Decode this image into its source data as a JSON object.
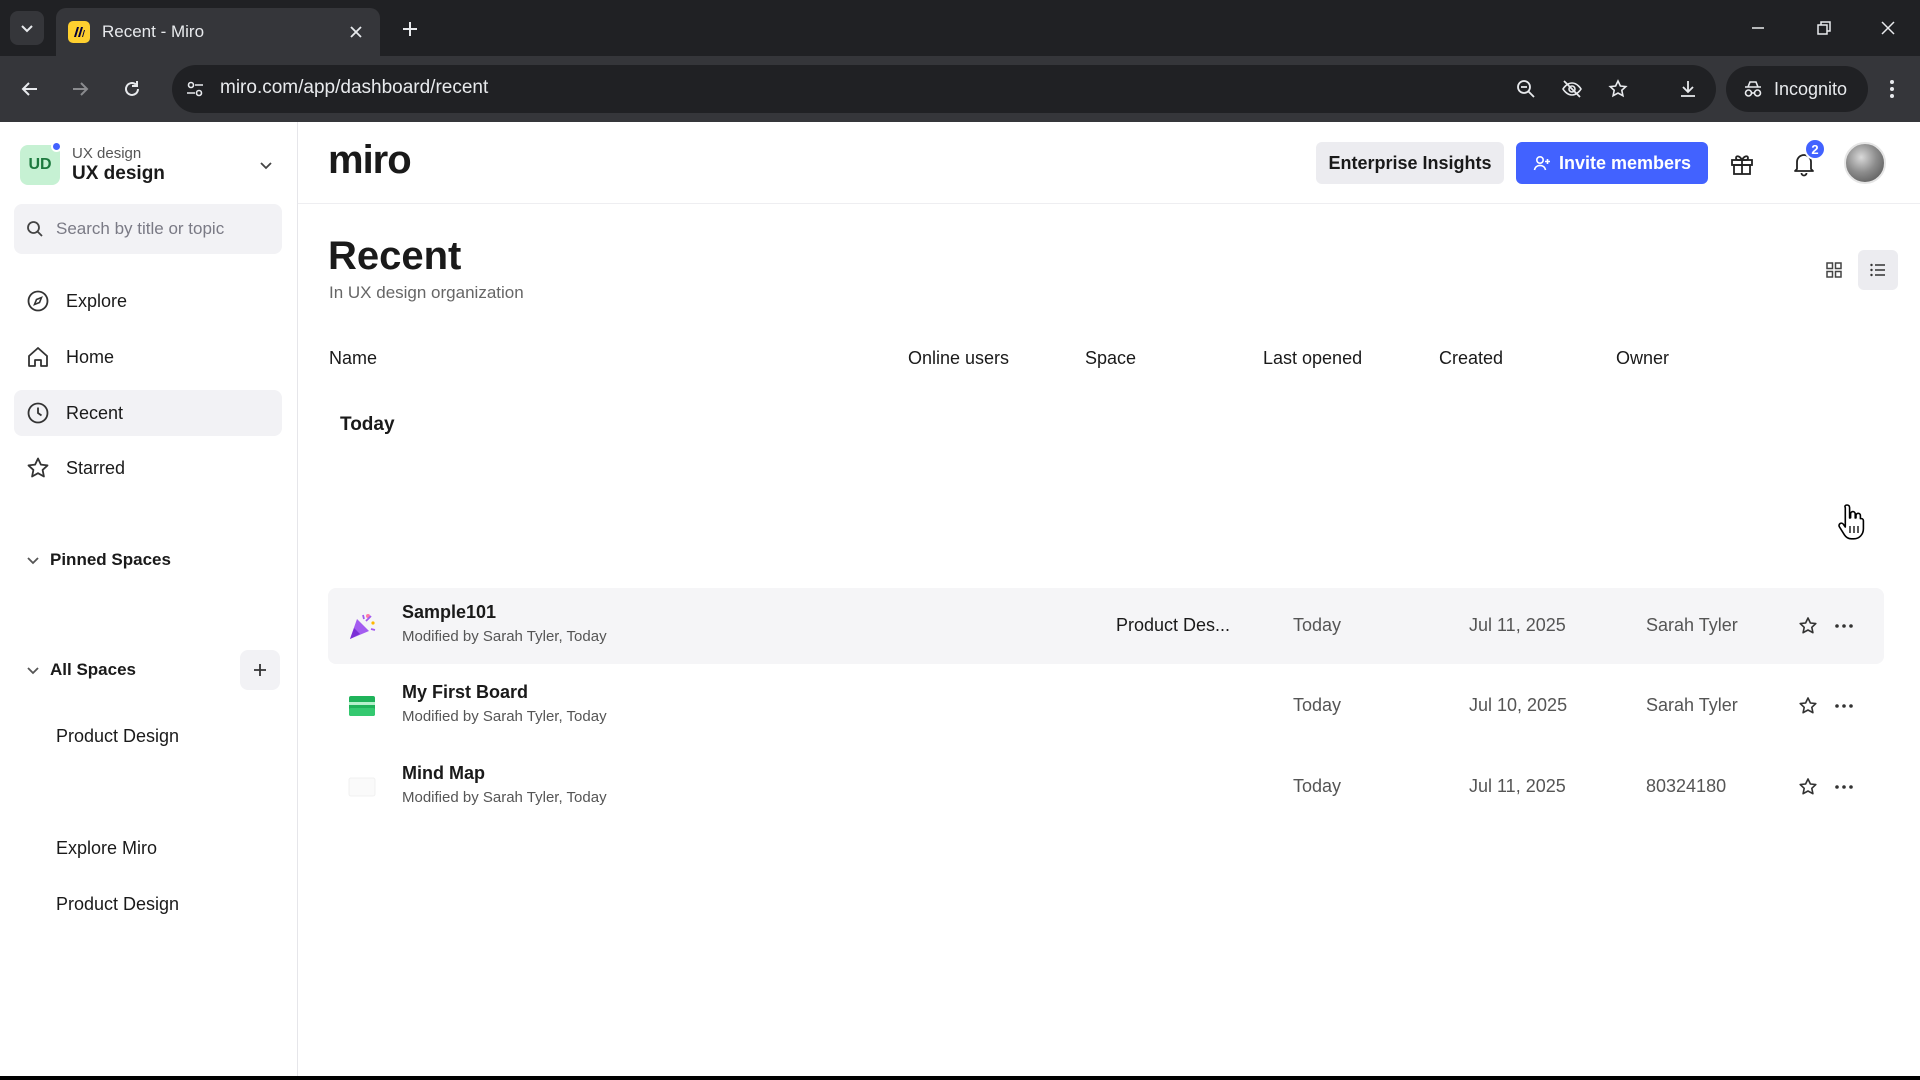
{
  "browser": {
    "tab_title": "Recent - Miro",
    "url": "miro.com/app/dashboard/recent",
    "incognito_label": "Incognito"
  },
  "sidebar": {
    "org_sub": "UX design",
    "org_name": "UX design",
    "org_initials": "UD",
    "search_placeholder": "Search by title or topic",
    "nav": [
      {
        "label": "Explore",
        "icon": "compass-icon"
      },
      {
        "label": "Home",
        "icon": "home-icon"
      },
      {
        "label": "Recent",
        "icon": "clock-icon"
      },
      {
        "label": "Starred",
        "icon": "star-icon"
      }
    ],
    "pinned_title": "Pinned Spaces",
    "pinned": [
      "Product Design"
    ],
    "all_title": "All Spaces",
    "all": [
      "Explore Miro",
      "Product Design"
    ]
  },
  "header": {
    "logo": "miro",
    "insights_label": "Enterprise Insights",
    "invite_label": "Invite members",
    "notification_count": "2"
  },
  "page": {
    "title": "Recent",
    "subtitle": "In UX design organization"
  },
  "table": {
    "columns": [
      "Name",
      "Online users",
      "Space",
      "Last opened",
      "Created",
      "Owner"
    ],
    "group": "Today",
    "rows": [
      {
        "name": "Sample101",
        "modified": "Modified by Sarah Tyler, Today",
        "space": "Product Des...",
        "last_opened": "Today",
        "created": "Jul 11, 2025",
        "owner": "Sarah Tyler",
        "icon": "party-popper-icon"
      },
      {
        "name": "My First Board",
        "modified": "Modified by Sarah Tyler, Today",
        "space": "",
        "last_opened": "Today",
        "created": "Jul 10, 2025",
        "owner": "Sarah Tyler",
        "icon": "green-board-icon"
      },
      {
        "name": "Mind Map",
        "modified": "Modified by Sarah Tyler, Today",
        "space": "",
        "last_opened": "Today",
        "created": "Jul 11, 2025",
        "owner": "80324180",
        "icon": "blank-board-icon"
      }
    ]
  },
  "colors": {
    "accent": "#4262ff",
    "tab_favicon": "#ffd02f",
    "org_badge": "#c6f1d3"
  }
}
